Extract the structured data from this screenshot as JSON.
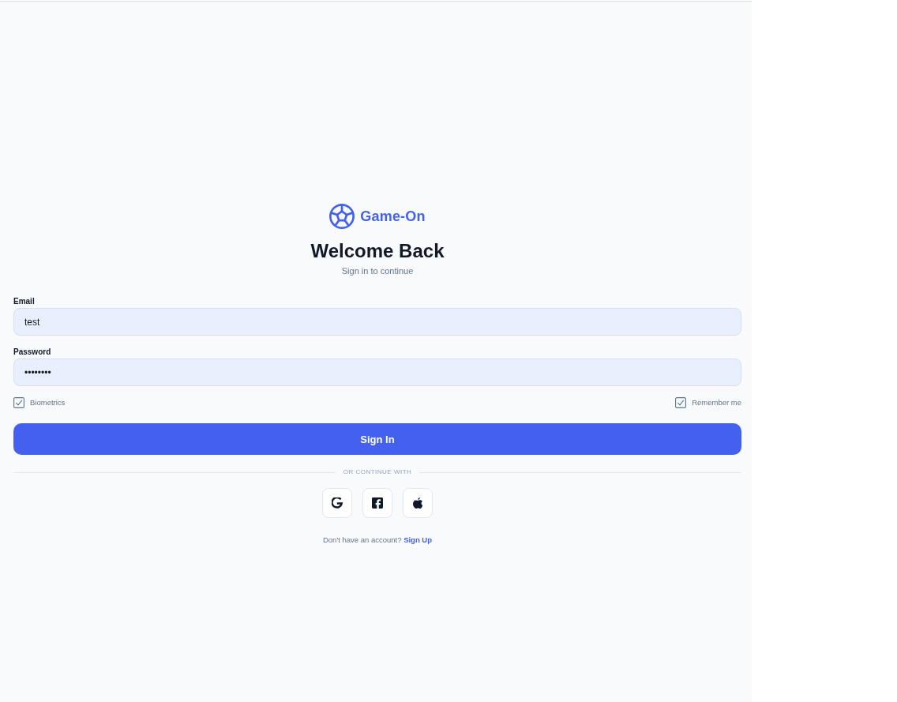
{
  "brand": {
    "name": "Game-On"
  },
  "header": {
    "title": "Welcome Back",
    "subtitle": "Sign in to continue"
  },
  "fields": [
    {
      "label": "Email",
      "kind": "text",
      "value": "test"
    },
    {
      "label": "Password",
      "kind": "password",
      "value": "••••••••"
    }
  ],
  "options": [
    {
      "label": "Biometrics",
      "checked": true
    },
    {
      "label": "Remember me",
      "checked": true
    }
  ],
  "sign_in_button": "Sign In",
  "divider": "OR CONTINUE WITH",
  "social_buttons": [
    {
      "kind": "google"
    },
    {
      "kind": "facebook"
    },
    {
      "kind": "apple"
    }
  ],
  "footer": {
    "text": "Don't have an account?",
    "link": "Sign Up"
  }
}
